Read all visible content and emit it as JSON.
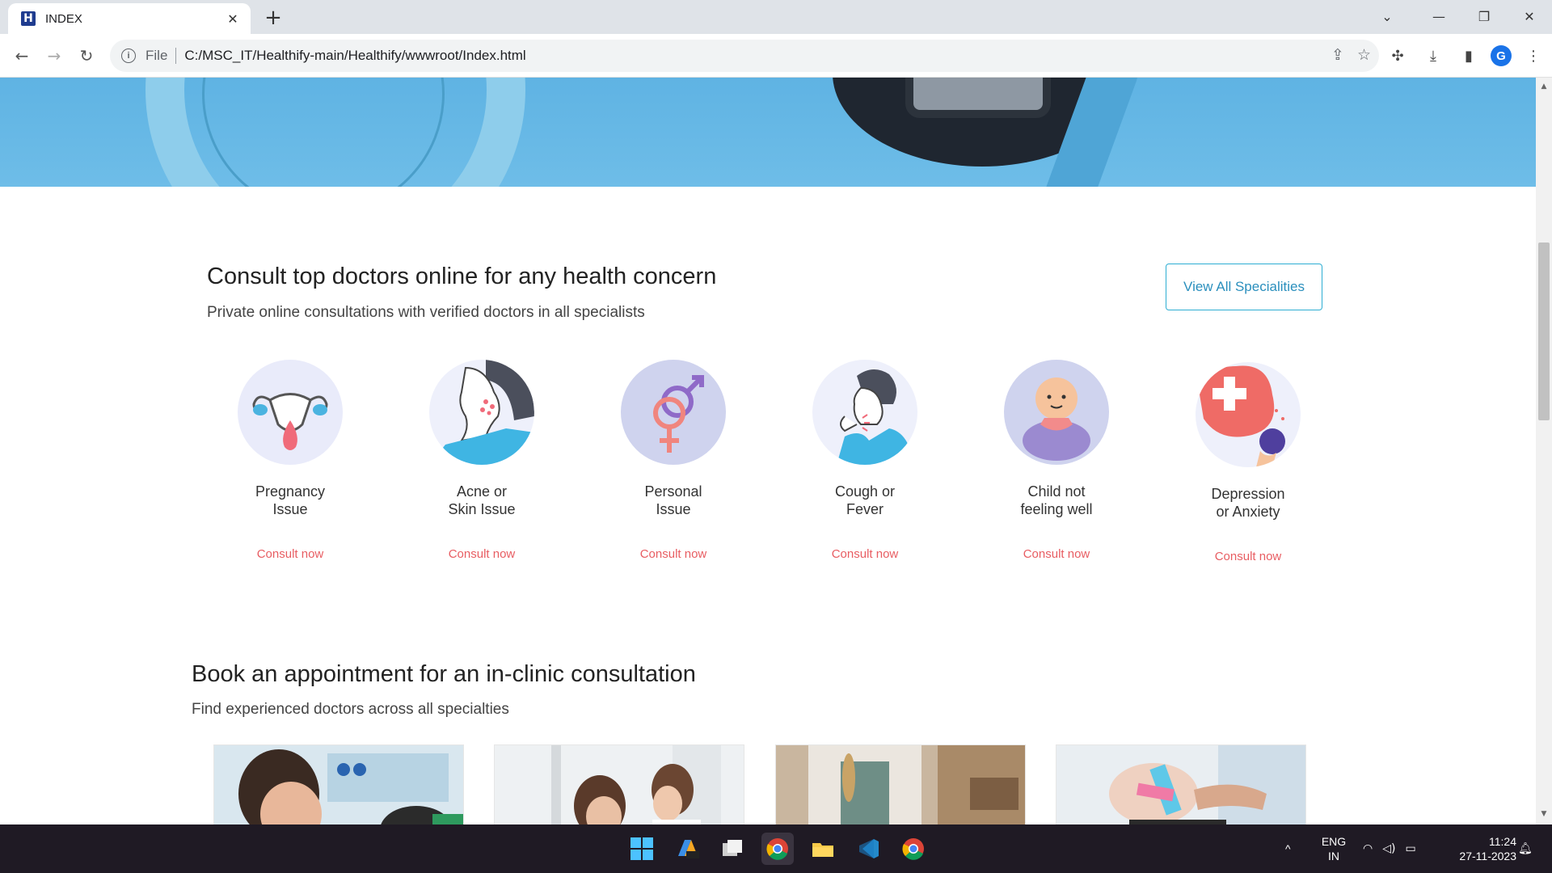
{
  "browser": {
    "tab_title": "INDEX",
    "favicon_letter": "H",
    "url_scheme": "File",
    "url": "C:/MSC_IT/Healthify-main/Healthify/wwwroot/Index.html",
    "avatar_letter": "G"
  },
  "consult": {
    "title": "Consult top doctors online for any health concern",
    "subtitle": "Private online consultations with verified doctors in all specialists",
    "view_all": "View All Specialities",
    "cta": "Consult now",
    "specialities": [
      {
        "line1": "Pregnancy",
        "line2": "Issue",
        "icon": "pregnancy-icon"
      },
      {
        "line1": "Acne or",
        "line2": "Skin Issue",
        "icon": "skin-icon"
      },
      {
        "line1": "Personal",
        "line2": "Issue",
        "icon": "gender-icon"
      },
      {
        "line1": "Cough or",
        "line2": "Fever",
        "icon": "cough-icon"
      },
      {
        "line1": "Child not",
        "line2": "feeling well",
        "icon": "baby-icon"
      },
      {
        "line1": "Depression",
        "line2": "or Anxiety",
        "icon": "mental-health-icon"
      }
    ]
  },
  "clinic": {
    "title": "Book an appointment for an in-clinic consultation",
    "subtitle": "Find experienced doctors across all specialties"
  },
  "taskbar": {
    "lang_line1": "ENG",
    "lang_line2": "IN",
    "time": "11:24",
    "date": "27-11-2023"
  },
  "colors": {
    "accent": "#2eaed3",
    "cta": "#e85d62",
    "hero": "#6ebde8"
  }
}
